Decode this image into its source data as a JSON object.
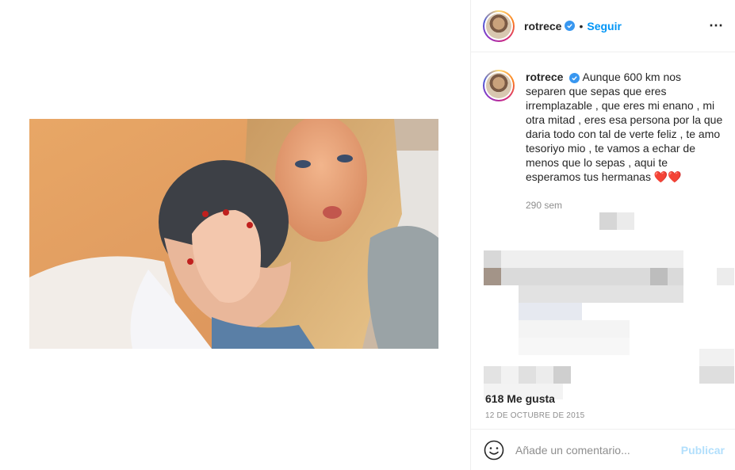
{
  "post": {
    "username": "rotrece",
    "separator": "•",
    "follow_label": "Seguir",
    "more_icon": "⋯",
    "caption_text": "Aunque 600 km nos separen que sepas que eres irremplazable , que eres mi enano , mi otra mitad , eres esa persona por la que daria todo con tal de verte feliz , te amo tesoriyo mio , te vamos a echar de menos que lo sepas , aqui te esperamos tus hermanas",
    "caption_emoji": "❤️❤️",
    "time_ago": "290 sem",
    "likes_label": "618 Me gusta",
    "date": "12 DE OCTUBRE DE 2015"
  },
  "comment": {
    "placeholder": "Añade un comentario...",
    "publish_label": "Publicar"
  },
  "colors": {
    "accent": "#0095f6",
    "verified": "#3897f0",
    "publish_disabled": "#b2dffc",
    "muted": "#8e8e8e"
  },
  "icons": {
    "verified": "verified-badge-icon",
    "more": "more-options-icon",
    "emoji": "emoji-icon"
  }
}
